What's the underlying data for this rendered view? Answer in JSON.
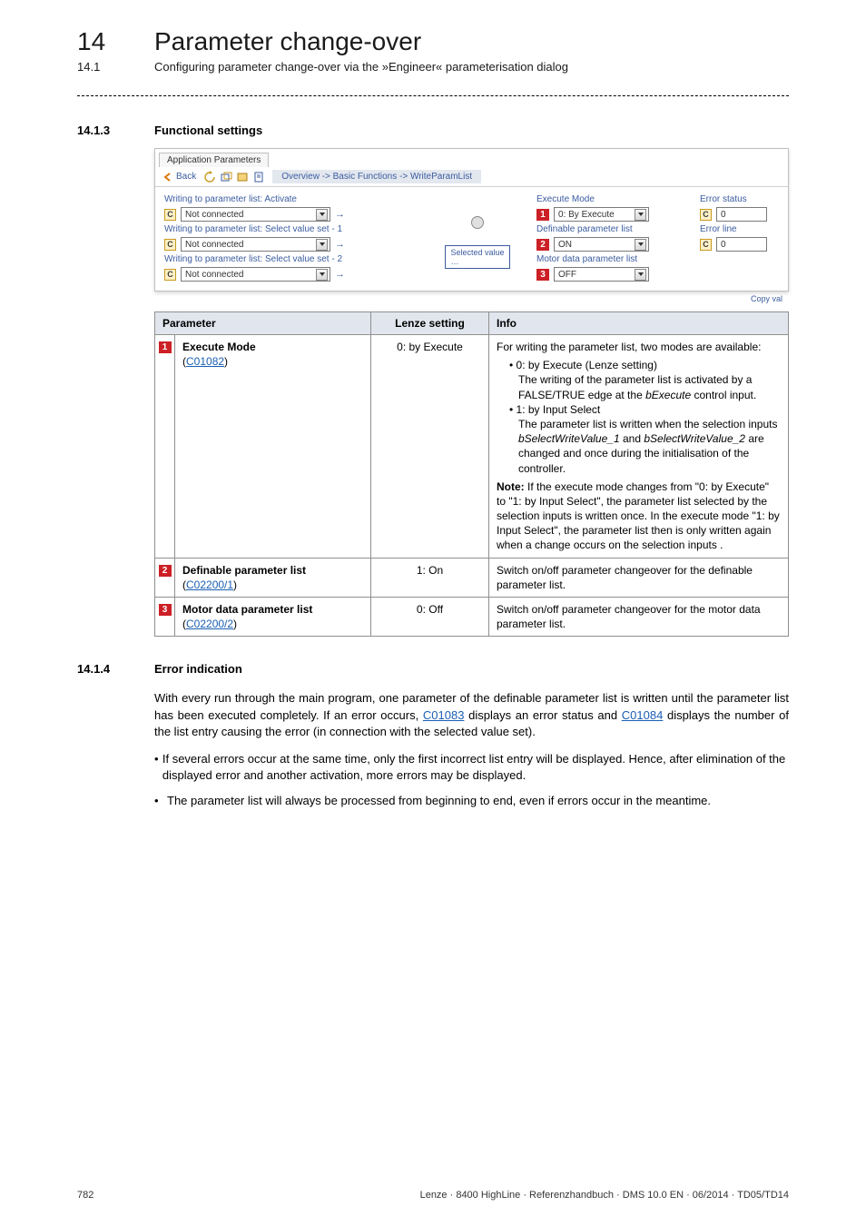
{
  "header": {
    "chapter_num": "14",
    "chapter_title": "Parameter change-over",
    "sub_num": "14.1",
    "sub_title": "Configuring parameter change-over via the »Engineer« parameterisation dialog"
  },
  "sec1": {
    "num": "14.1.3",
    "title": "Functional settings"
  },
  "sec2": {
    "num": "14.1.4",
    "title": "Error indication"
  },
  "panel": {
    "tab": "Application Parameters",
    "back": "Back",
    "breadcrumb": "Overview -> Basic Functions -> WriteParamList",
    "left": {
      "lab_activate": "Writing to parameter list: Activate",
      "nc1": "Not connected",
      "lab_ss1": "Writing to parameter list: Select value set - 1",
      "nc2": "Not connected",
      "lab_ss2": "Writing to parameter list: Select value set - 2",
      "nc3": "Not connected"
    },
    "mid": {
      "sel": "Selected value",
      "dots": "…"
    },
    "right": {
      "lab_exec": "Execute Mode",
      "val_exec": "0: By Execute",
      "lab_def": "Definable parameter list",
      "val_def": "ON",
      "lab_mot": "Motor data parameter list",
      "val_mot": "OFF"
    },
    "status": {
      "lab_err": "Error status",
      "val_err": "0",
      "lab_line": "Error line",
      "val_line": "0"
    },
    "copy": "Copy val"
  },
  "table": {
    "head": {
      "param": "Parameter",
      "setting": "Lenze setting",
      "info": "Info"
    },
    "tags": {
      "t1": "1",
      "t2": "2",
      "t3": "3"
    },
    "r1": {
      "name": "Execute Mode",
      "link": "C01082",
      "setting": "0: by Execute",
      "info_a": "For writing the parameter list, two modes are available:",
      "b0": "• 0: by Execute (Lenze setting)",
      "b0d": "The writing of the parameter list is activated by a FALSE/TRUE edge at the",
      "b0d_em": "bExecute",
      "b0d2": "control input.",
      "b1": "• 1: by Input Select",
      "b1d": "The parameter list is written when the selection inputs",
      "b1d_em1": "bSelectWriteValue_1",
      "b1d_a": "and",
      "b1d_em2": "bSelectWriteValue_2",
      "b1d2": "are changed and once during the initialisation of the controller.",
      "note_lbl": "Note:",
      "note_txt": "If the execute mode changes from \"0: by Execute\" to \"1: by Input Select\", the parameter list selected by the selection inputs is written once. In the execute mode \"1: by Input Select\", the parameter list then is only written again when a change occurs on the selection inputs .",
      "parens_o": "(",
      "parens_c": ")"
    },
    "r2": {
      "name": "Definable parameter list",
      "link": "C02200/1",
      "setting": "1: On",
      "info": "Switch on/off parameter changeover for the definable parameter list."
    },
    "r3": {
      "name": "Motor data parameter list",
      "link": "C02200/2",
      "setting": "0: Off",
      "info": "Switch on/off parameter changeover for the motor data parameter list."
    }
  },
  "errsec": {
    "p1a": "With every run through the main program, one parameter of the definable parameter list is written until the parameter list has been executed completely. If an error occurs,",
    "link1": "C01083",
    "p1b": "displays an error status and",
    "link2": "C01084",
    "p1c": "displays the number of the list entry causing the error (in connection with the selected value set).",
    "b1": "If several errors occur at the same time, only the first incorrect list entry will be displayed. Hence, after elimination of the displayed error and another activation, more errors may be displayed.",
    "b2": "The parameter list will always be processed from beginning to end, even if errors occur in the meantime."
  },
  "footer": {
    "page": "782",
    "doc": "Lenze · 8400 HighLine · Referenzhandbuch · DMS 10.0 EN · 06/2014 · TD05/TD14"
  }
}
